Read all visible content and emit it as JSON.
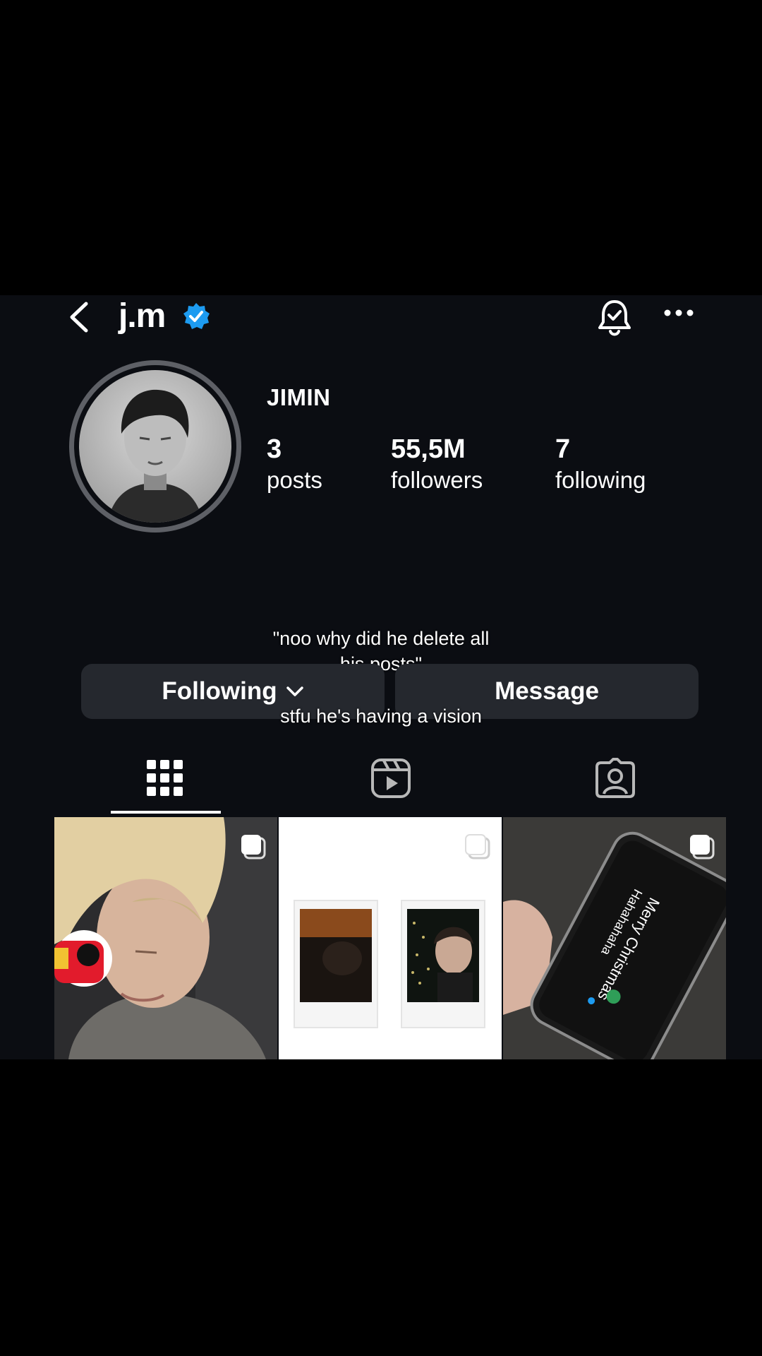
{
  "profile": {
    "username": "j.m",
    "display_name": "JIMIN",
    "stats": [
      {
        "value": "3",
        "label": "posts"
      },
      {
        "value": "55,5M",
        "label": "followers"
      },
      {
        "value": "7",
        "label": "following"
      }
    ]
  },
  "actions": {
    "following_label": "Following",
    "message_label": "Message"
  },
  "caption": {
    "line1": "\"noo why did he delete all",
    "line2": "his posts\"",
    "line3": "stfu he's having a vision"
  },
  "posts": {
    "post3_text_1": "Merry Christmas",
    "post3_text_2": "Hahahahaha"
  },
  "icons": [
    "back-icon",
    "verified-icon",
    "bell-icon",
    "more-icon",
    "grid-icon",
    "reels-icon",
    "tagged-icon",
    "multi-post-icon"
  ],
  "colors": {
    "background": "#0b0d12",
    "button": "#25282e",
    "verified": "#1d9bf0",
    "text": "#ffffff"
  }
}
